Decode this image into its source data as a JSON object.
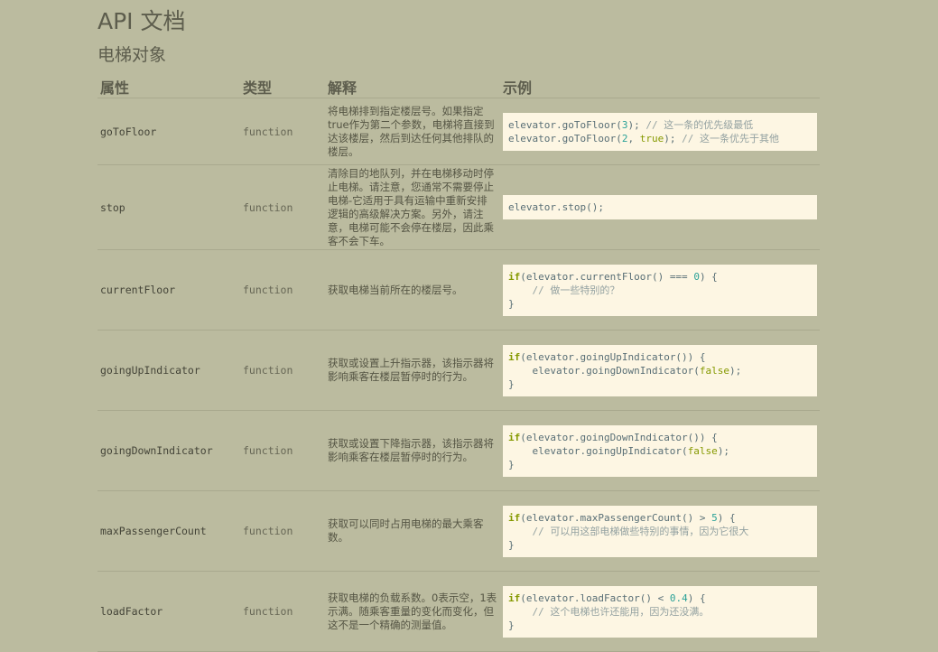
{
  "page": {
    "title": "API 文档",
    "subtitle": "电梯对象"
  },
  "table": {
    "headers": [
      "属性",
      "类型",
      "解释",
      "示例"
    ],
    "rows": [
      {
        "name": "goToFloor",
        "type": "function",
        "desc": "将电梯排到指定楼层号。如果指定true作为第二个参数，电梯将直接到达该楼层，然后到达任何其他排队的楼层。",
        "example": [
          [
            [
              "p",
              "elevator.goToFloor("
            ],
            [
              "n",
              "3"
            ],
            [
              "p",
              ");"
            ],
            [
              "c",
              " // 这一条的优先级最低"
            ]
          ],
          [
            [
              "p",
              "elevator.goToFloor("
            ],
            [
              "n",
              "2"
            ],
            [
              "p",
              ", "
            ],
            [
              "l",
              "true"
            ],
            [
              "p",
              ");"
            ],
            [
              "c",
              " // 这一条优先于其他"
            ]
          ]
        ]
      },
      {
        "name": "stop",
        "type": "function",
        "desc": "清除目的地队列，并在电梯移动时停止电梯。请注意，您通常不需要停止电梯-它适用于具有运输中重新安排逻辑的高级解决方案。另外，请注意，电梯可能不会停在楼层，因此乘客不会下车。",
        "example": [
          [
            [
              "p",
              "elevator.stop();"
            ]
          ]
        ]
      },
      {
        "name": "currentFloor",
        "type": "function",
        "desc": "获取电梯当前所在的楼层号。",
        "example": [
          [
            [
              "k",
              "if"
            ],
            [
              "p",
              "(elevator.currentFloor() === "
            ],
            [
              "n",
              "0"
            ],
            [
              "p",
              ") {"
            ]
          ],
          [
            [
              "c",
              "    // 做一些特别的？"
            ]
          ],
          [
            [
              "p",
              "}"
            ]
          ]
        ]
      },
      {
        "name": "goingUpIndicator",
        "type": "function",
        "desc": "获取或设置上升指示器，该指示器将影响乘客在楼层暂停时的行为。",
        "example": [
          [
            [
              "k",
              "if"
            ],
            [
              "p",
              "(elevator.goingUpIndicator()) {"
            ]
          ],
          [
            [
              "p",
              "    elevator.goingDownIndicator("
            ],
            [
              "l",
              "false"
            ],
            [
              "p",
              ");"
            ]
          ],
          [
            [
              "p",
              "}"
            ]
          ]
        ]
      },
      {
        "name": "goingDownIndicator",
        "type": "function",
        "desc": "获取或设置下降指示器，该指示器将影响乘客在楼层暂停时的行为。",
        "example": [
          [
            [
              "k",
              "if"
            ],
            [
              "p",
              "(elevator.goingDownIndicator()) {"
            ]
          ],
          [
            [
              "p",
              "    elevator.goingUpIndicator("
            ],
            [
              "l",
              "false"
            ],
            [
              "p",
              ");"
            ]
          ],
          [
            [
              "p",
              "}"
            ]
          ]
        ]
      },
      {
        "name": "maxPassengerCount",
        "type": "function",
        "desc": "获取可以同时占用电梯的最大乘客数。",
        "example": [
          [
            [
              "k",
              "if"
            ],
            [
              "p",
              "(elevator.maxPassengerCount() > "
            ],
            [
              "n",
              "5"
            ],
            [
              "p",
              ") {"
            ]
          ],
          [
            [
              "c",
              "    // 可以用这部电梯做些特别的事情，因为它很大"
            ]
          ],
          [
            [
              "p",
              "}"
            ]
          ]
        ]
      },
      {
        "name": "loadFactor",
        "type": "function",
        "desc": "获取电梯的负载系数。0表示空，1表示满。随乘客重量的变化而变化，但这不是一个精确的测量值。",
        "example": [
          [
            [
              "k",
              "if"
            ],
            [
              "p",
              "(elevator.loadFactor() < "
            ],
            [
              "n",
              "0.4"
            ],
            [
              "p",
              ") {"
            ]
          ],
          [
            [
              "c",
              "    // 这个电梯也许还能用，因为还没满。"
            ]
          ],
          [
            [
              "p",
              "}"
            ]
          ]
        ]
      }
    ]
  }
}
